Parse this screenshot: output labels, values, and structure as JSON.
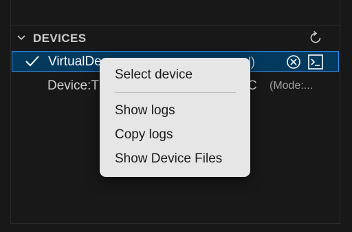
{
  "devices_section": {
    "title": "DEVICES",
    "refresh_icon": "refresh-icon"
  },
  "device_rows": [
    {
      "label": "VirtualDe",
      "suffix": "l)",
      "selected": true,
      "status_icon": "check-icon",
      "actions": [
        "close-circle-icon",
        "terminal-icon"
      ]
    },
    {
      "label": "Device:T",
      "mid": "C",
      "mode": "(Mode:...",
      "selected": false
    }
  ],
  "context_menu": {
    "items": [
      "Select device",
      "Show logs",
      "Copy logs",
      "Show Device Files"
    ]
  },
  "colors": {
    "background": "#181818",
    "selection": "#04395e",
    "selection_border": "#2f8ff0",
    "menu_background": "#e6e6e6"
  }
}
